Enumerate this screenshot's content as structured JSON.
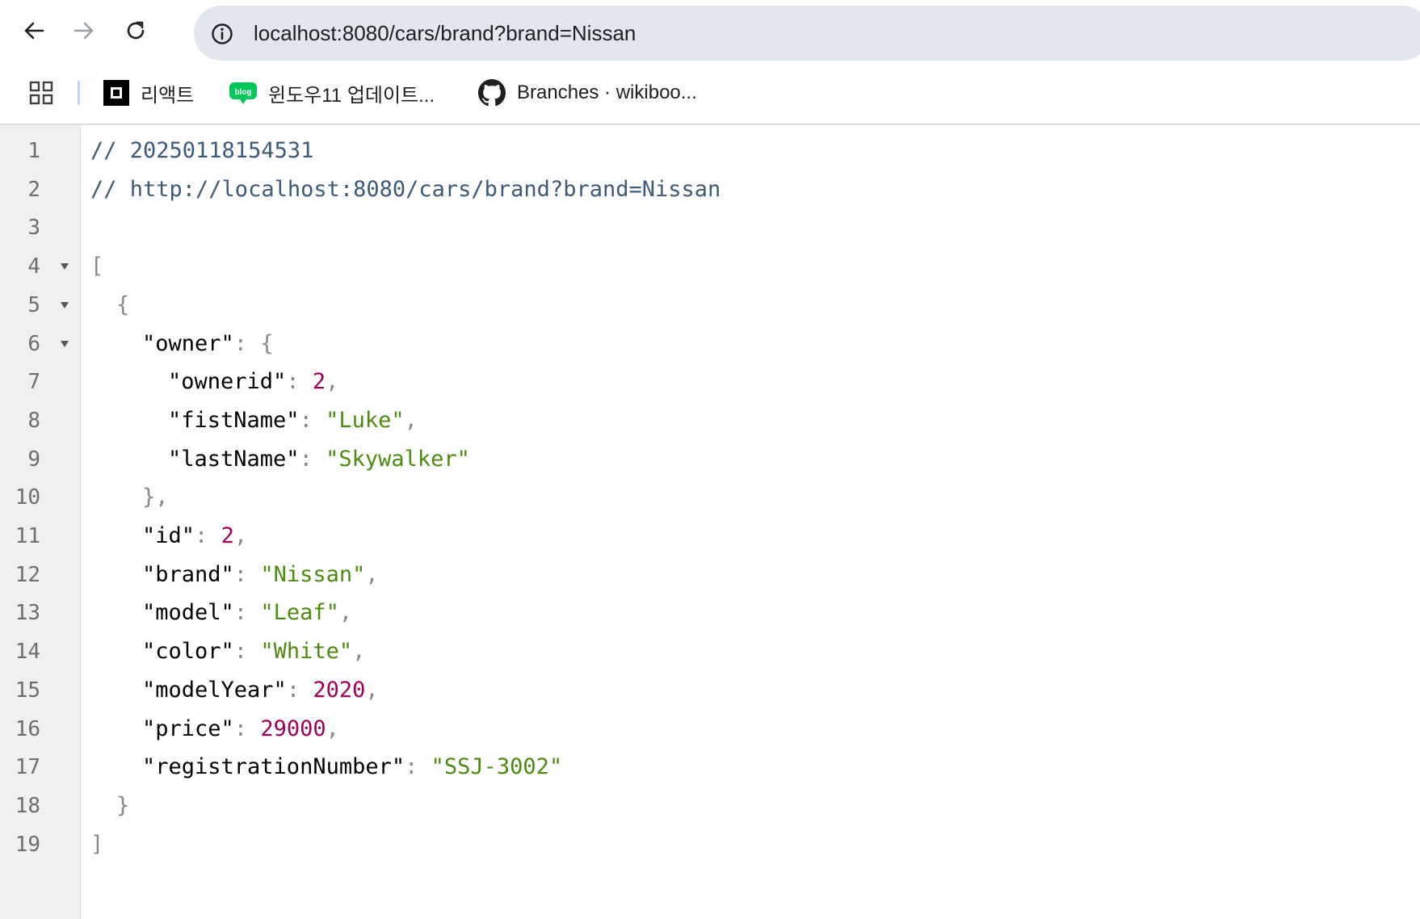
{
  "browser": {
    "url": "localhost:8080/cars/brand?brand=Nissan",
    "icons": {
      "back": "back-arrow-icon",
      "forward": "forward-arrow-icon",
      "reload": "reload-icon",
      "site_info": "info-circle-icon"
    }
  },
  "bookmarks": [
    {
      "label": "리액트",
      "icon": "react-favicon-icon"
    },
    {
      "label": "윈도우11 업데이트...",
      "icon": "blog-favicon-icon",
      "favicon_text": "blog"
    },
    {
      "label": "Branches · wikiboo...",
      "icon": "github-icon"
    }
  ],
  "code": {
    "lines": [
      {
        "n": "1",
        "text": "// 20250118154531"
      },
      {
        "n": "2",
        "text": "// http://localhost:8080/cars/brand?brand=Nissan"
      },
      {
        "n": "3",
        "text": ""
      },
      {
        "n": "4",
        "text": "[",
        "fold": true
      },
      {
        "n": "5",
        "text": "{",
        "fold": true
      },
      {
        "n": "6",
        "text": "\"owner\": {",
        "fold": true
      },
      {
        "n": "7",
        "text": "\"ownerid\": 2,"
      },
      {
        "n": "8",
        "text": "\"fistName\": \"Luke\","
      },
      {
        "n": "9",
        "text": "\"lastName\": \"Skywalker\""
      },
      {
        "n": "10",
        "text": "},"
      },
      {
        "n": "11",
        "text": "\"id\": 2,"
      },
      {
        "n": "12",
        "text": "\"brand\": \"Nissan\","
      },
      {
        "n": "13",
        "text": "\"model\": \"Leaf\","
      },
      {
        "n": "14",
        "text": "\"color\": \"White\","
      },
      {
        "n": "15",
        "text": "\"modelYear\": 2020,"
      },
      {
        "n": "16",
        "text": "\"price\": 29000,"
      },
      {
        "n": "17",
        "text": "\"registrationNumber\": \"SSJ-3002\""
      },
      {
        "n": "18",
        "text": "}"
      },
      {
        "n": "19",
        "text": "]"
      }
    ]
  },
  "colors": {
    "comment": "#3d5a78",
    "string": "#4f8a10",
    "number": "#a1005a",
    "punctuation": "#888888",
    "gutter_bg": "#f0f0f0",
    "omnibox_bg": "#e2e6ee"
  }
}
